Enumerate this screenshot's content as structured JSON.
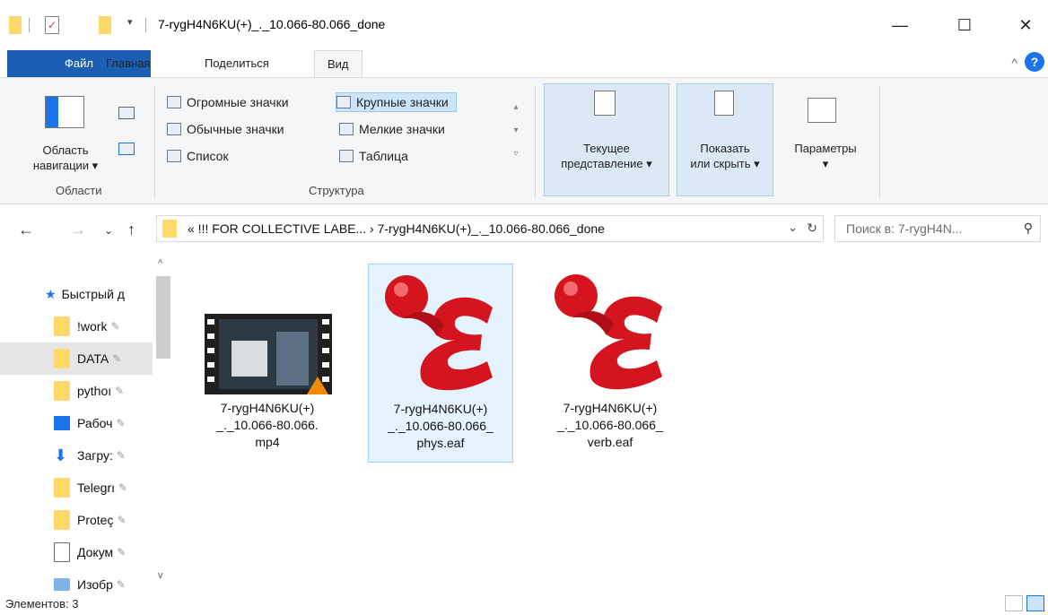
{
  "window": {
    "title": "7-rygH4N6KU(+)_._10.066-80.066_done",
    "minimize": "—",
    "maximize": "☐",
    "close": "✕"
  },
  "tabs": [
    "Файл",
    "Главная",
    "Поделиться",
    "Вид"
  ],
  "ribbon": {
    "nav_pane_label_1": "Область",
    "nav_pane_label_2": "навигации ▾",
    "groups": {
      "areas": "Области",
      "structure": "Структура"
    },
    "layouts": [
      "Огромные значки",
      "Крупные значки",
      "Обычные значки",
      "Мелкие значки",
      "Список",
      "Таблица"
    ],
    "current_view_1": "Текущее",
    "current_view_2": "представление ▾",
    "show_hide_1": "Показать",
    "show_hide_2": "или скрыть ▾",
    "options": "Параметры",
    "options_caret": "▾"
  },
  "address": {
    "path": "«  !!! FOR COLLECTIVE LABE...  ›  7-rygH4N6KU(+)_._10.066-80.066_done",
    "search_placeholder": "Поиск в: 7-rygH4N..."
  },
  "sidebar": {
    "items": [
      "Быстрый д",
      "!work",
      "DATA",
      "pythoı",
      "Рабоч",
      "Загру:",
      "Telegrı",
      "Proteç",
      "Докум",
      "Изобр"
    ]
  },
  "files": [
    {
      "name_l1": "7-rygH4N6KU(+)",
      "name_l2": "_._10.066-80.066.",
      "name_l3": "mp4"
    },
    {
      "name_l1": "7-rygH4N6KU(+)",
      "name_l2": "_._10.066-80.066_",
      "name_l3": "phys.eaf"
    },
    {
      "name_l1": "7-rygH4N6KU(+)",
      "name_l2": "_._10.066-80.066_",
      "name_l3": "verb.eaf"
    }
  ],
  "status": {
    "count": "Элементов: 3"
  },
  "colors": {
    "accent": "#1a5fb4",
    "folder": "#ffd969",
    "elan_red": "#d4141e"
  }
}
